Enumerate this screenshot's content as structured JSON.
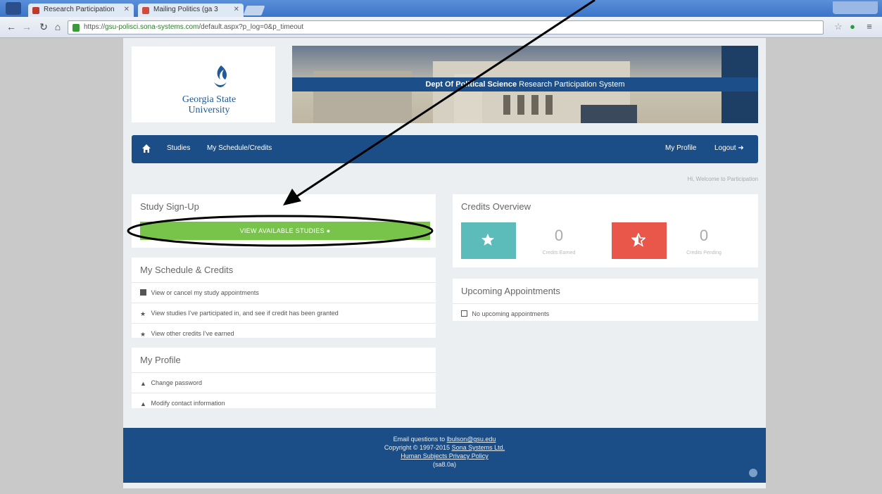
{
  "browser": {
    "tabs": [
      {
        "label": "Research Participation",
        "favicon_color": "#c0392b"
      },
      {
        "label": "Mailing Politics (ga 3",
        "favicon_color": "#d24b3b"
      }
    ],
    "url_prefix": "https://",
    "url_host": "gsu-polisci.sona-systems.com",
    "url_path": "/default.aspx?p_log=0&p_timeout"
  },
  "header": {
    "logo_line1": "Georgia State",
    "logo_line2": "University",
    "banner_bold": "Dept Of Political Science",
    "banner_text": "Research Participation System"
  },
  "nav": {
    "studies": "Studies",
    "schedule": "My Schedule/Credits",
    "profile": "My Profile",
    "logout": "Logout"
  },
  "welcome": "Hi, Welcome to Participation",
  "signup": {
    "title": "Study Sign-Up",
    "button": "VIEW AVAILABLE STUDIES"
  },
  "schedule": {
    "title": "My Schedule & Credits",
    "items": [
      "View or cancel my study appointments",
      "View studies I've participated in, and see if credit has been granted",
      "View other credits I've earned"
    ]
  },
  "profile": {
    "title": "My Profile",
    "items": [
      "Change password",
      "Modify contact information"
    ]
  },
  "credits": {
    "title": "Credits Overview",
    "earned_value": "0",
    "earned_label": "Credits Earned",
    "pending_value": "0",
    "pending_label": "Credits Pending",
    "earned_color": "#5bbcb9",
    "pending_color": "#e9574a"
  },
  "appointments": {
    "title": "Upcoming Appointments",
    "empty_text": "No upcoming appointments"
  },
  "footer": {
    "line1_prefix": "Email questions to",
    "line1_email": "lbulson@gsu.edu",
    "line2_prefix": "Copyright © 1997-2015",
    "line2_link": "Sona Systems Ltd.",
    "line3": "Human Subjects Privacy Policy",
    "line4": "(sa8.0a)"
  }
}
